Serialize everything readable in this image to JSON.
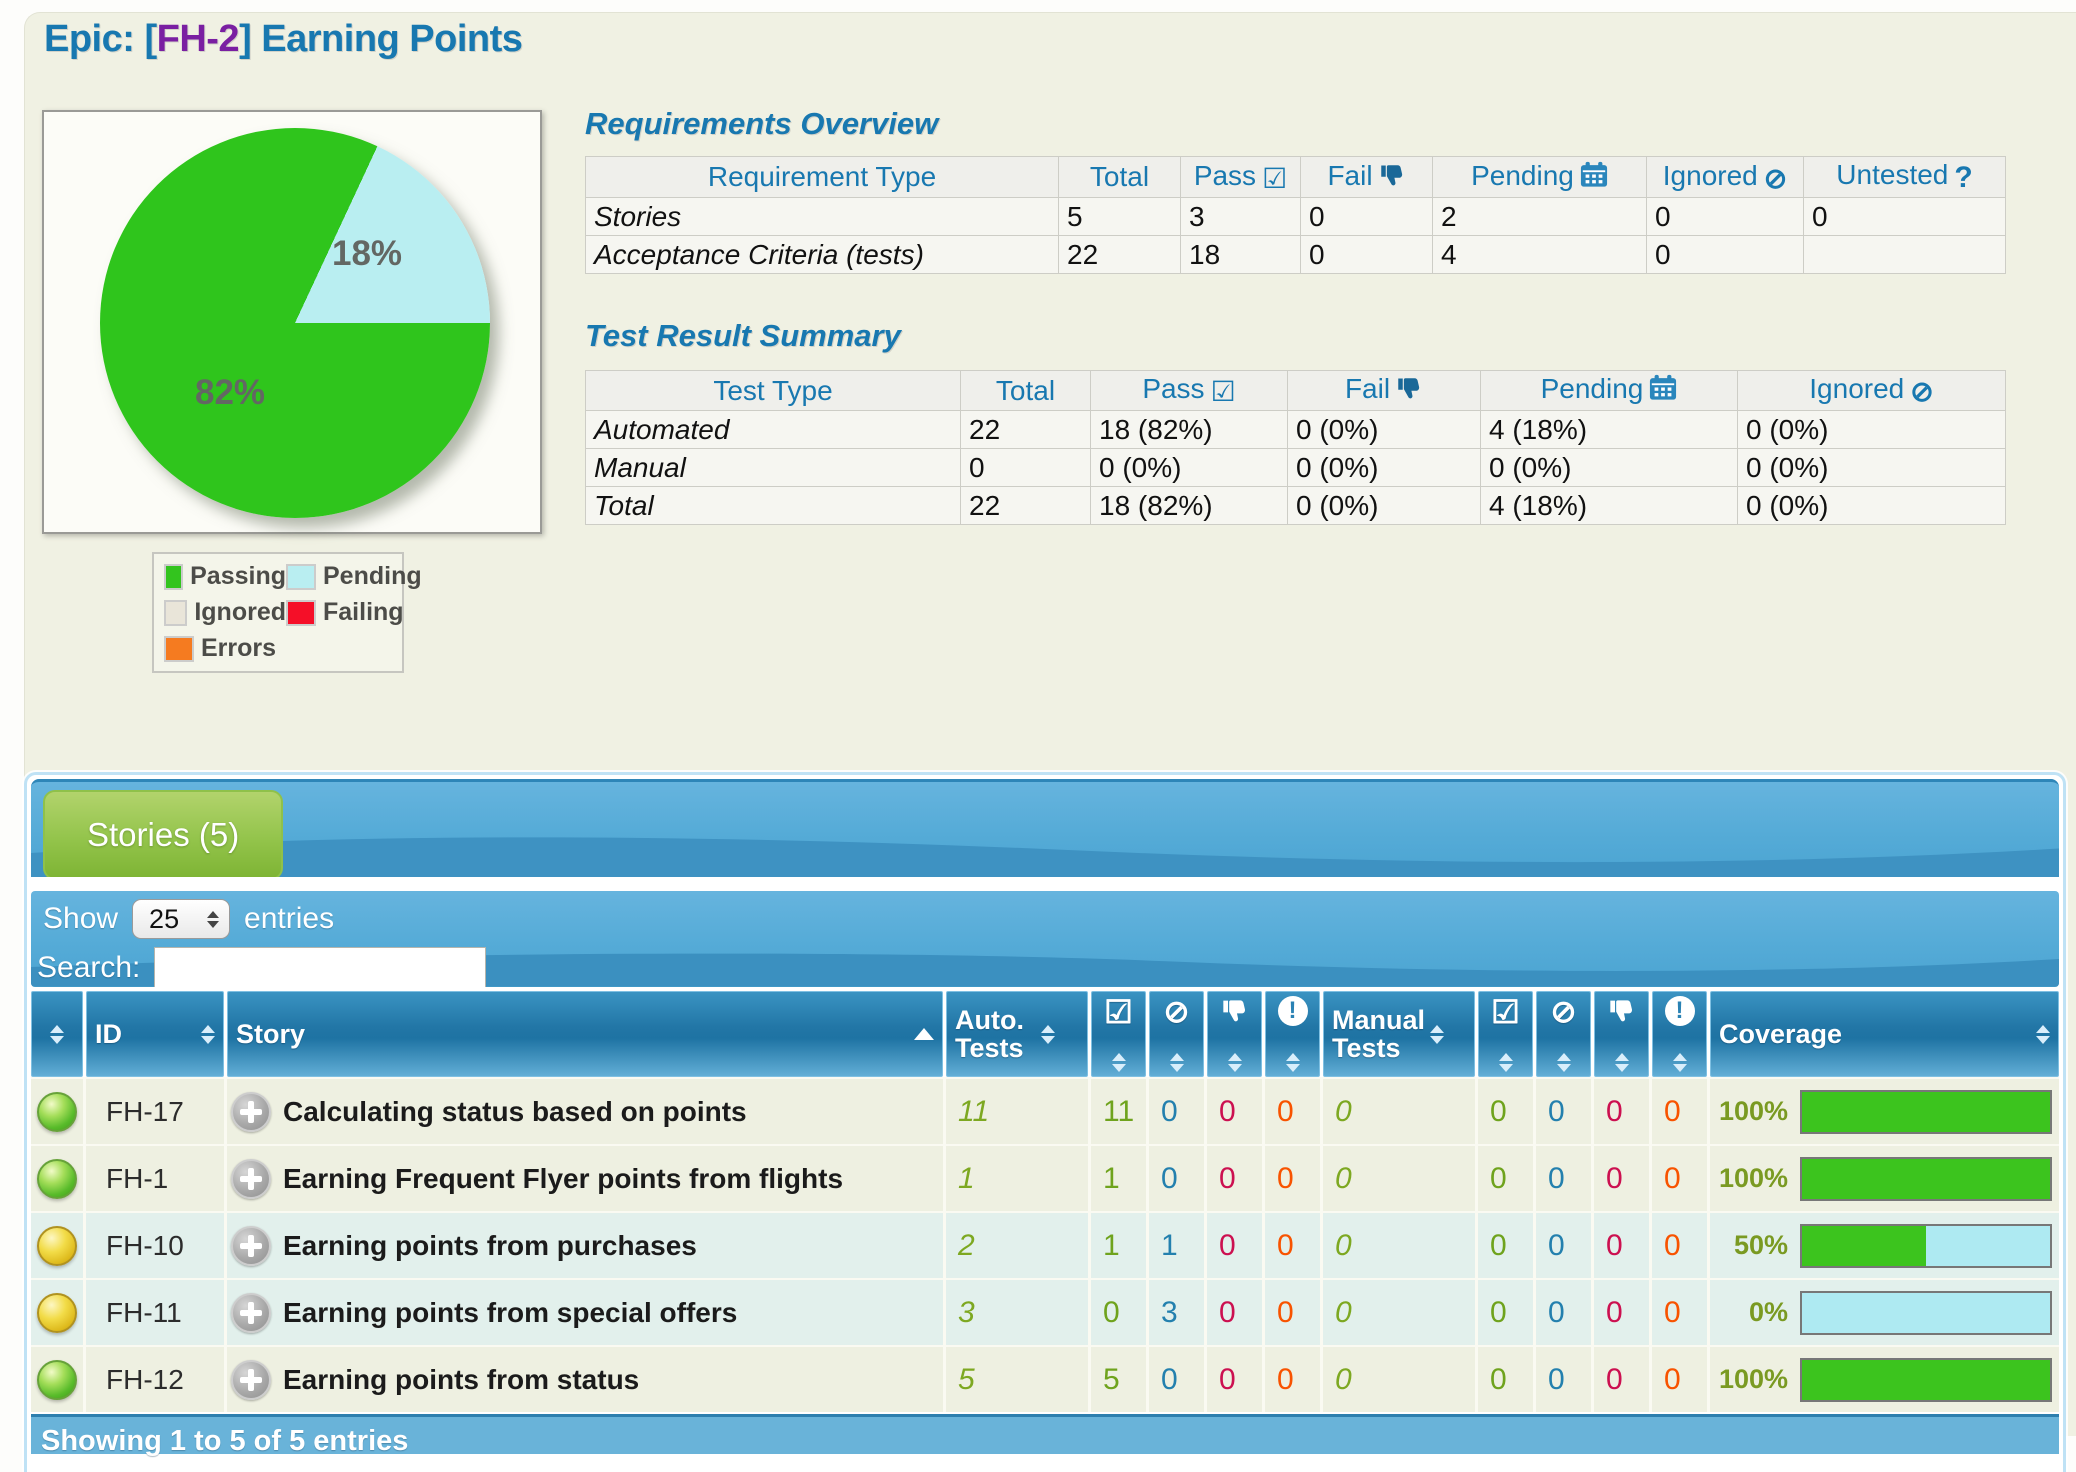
{
  "page_title": {
    "pre": "Epic: [",
    "key": "FH-2",
    "post": "] Earning Points"
  },
  "chart_data": {
    "type": "pie",
    "title": "Epic test results",
    "slices": [
      {
        "label": "Passing",
        "pct": 82,
        "color": "#2fc51c"
      },
      {
        "label": "Pending",
        "pct": 18,
        "color": "#b9eef1"
      }
    ],
    "slice_labels": {
      "passing": "82%",
      "pending": "18%"
    },
    "legend": [
      {
        "label": "Passing",
        "color": "#33c41e"
      },
      {
        "label": "Pending",
        "color": "#b9eef1"
      },
      {
        "label": "Ignored",
        "color": "#e9e5d9"
      },
      {
        "label": "Failing",
        "color": "#f50f28"
      },
      {
        "label": "Errors",
        "color": "#f57b20"
      }
    ]
  },
  "icons": {
    "checkbox_glyph": "☑",
    "no_entry_glyph": "⊘",
    "question_glyph": "?",
    "error_glyph": "!"
  },
  "requirements_overview": {
    "title": "Requirements Overview",
    "columns": [
      "Requirement Type",
      "Total",
      "Pass",
      "Fail",
      "Pending",
      "Ignored",
      "Untested"
    ],
    "rows": [
      {
        "type": "Stories",
        "total": "5",
        "pass": "3",
        "fail": "0",
        "pending": "2",
        "ignored": "0",
        "untested": "0"
      },
      {
        "type": "Acceptance Criteria (tests)",
        "total": "22",
        "pass": "18",
        "fail": "0",
        "pending": "4",
        "ignored": "0",
        "untested": ""
      }
    ]
  },
  "test_result_summary": {
    "title": "Test Result Summary",
    "columns": [
      "Test Type",
      "Total",
      "Pass",
      "Fail",
      "Pending",
      "Ignored"
    ],
    "rows": [
      {
        "type": "Automated",
        "total": "22",
        "pass": "18 (82%)",
        "fail": "0 (0%)",
        "pending": "4 (18%)",
        "ignored": "0 (0%)"
      },
      {
        "type": "Manual",
        "total": "0",
        "pass": "0 (0%)",
        "fail": "0 (0%)",
        "pending": "0 (0%)",
        "ignored": "0 (0%)"
      },
      {
        "type": "Total",
        "total": "22",
        "pass": "18 (82%)",
        "fail": "0 (0%)",
        "pending": "4 (18%)",
        "ignored": "0 (0%)"
      }
    ]
  },
  "stories": {
    "tab_label": "Stories (5)",
    "show_label": "Show",
    "entries_label": "entries",
    "page_size": "25",
    "search_label": "Search:",
    "search_value": "",
    "columns": {
      "id": "ID",
      "story": "Story",
      "auto_tests": "Auto. Tests",
      "manual_tests": "Manual Tests",
      "coverage": "Coverage"
    },
    "icon_columns": [
      "pass",
      "skipped",
      "fail",
      "error"
    ],
    "rows": [
      {
        "status": "green",
        "shade": "base",
        "id": "FH-17",
        "title": "Calculating status based on points",
        "auto_total": "11",
        "auto_pass": "11",
        "auto_skip": "0",
        "auto_fail": "0",
        "auto_err": "0",
        "man_total": "0",
        "man_pass": "0",
        "man_skip": "0",
        "man_fail": "0",
        "man_err": "0",
        "cov_label": "100%",
        "cov_pct": 100
      },
      {
        "status": "green",
        "shade": "base",
        "id": "FH-1",
        "title": "Earning Frequent Flyer points from flights",
        "auto_total": "1",
        "auto_pass": "1",
        "auto_skip": "0",
        "auto_fail": "0",
        "auto_err": "0",
        "man_total": "0",
        "man_pass": "0",
        "man_skip": "0",
        "man_fail": "0",
        "man_err": "0",
        "cov_label": "100%",
        "cov_pct": 100
      },
      {
        "status": "yellow",
        "shade": "alt",
        "id": "FH-10",
        "title": "Earning points from purchases",
        "auto_total": "2",
        "auto_pass": "1",
        "auto_skip": "1",
        "auto_fail": "0",
        "auto_err": "0",
        "man_total": "0",
        "man_pass": "0",
        "man_skip": "0",
        "man_fail": "0",
        "man_err": "0",
        "cov_label": "50%",
        "cov_pct": 50
      },
      {
        "status": "yellow",
        "shade": "alt",
        "id": "FH-11",
        "title": "Earning points from special offers",
        "auto_total": "3",
        "auto_pass": "0",
        "auto_skip": "3",
        "auto_fail": "0",
        "auto_err": "0",
        "man_total": "0",
        "man_pass": "0",
        "man_skip": "0",
        "man_fail": "0",
        "man_err": "0",
        "cov_label": "0%",
        "cov_pct": 0
      },
      {
        "status": "green",
        "shade": "base",
        "id": "FH-12",
        "title": "Earning points from status",
        "auto_total": "5",
        "auto_pass": "5",
        "auto_skip": "0",
        "auto_fail": "0",
        "auto_err": "0",
        "man_total": "0",
        "man_pass": "0",
        "man_skip": "0",
        "man_fail": "0",
        "man_err": "0",
        "cov_label": "100%",
        "cov_pct": 100
      }
    ],
    "footer_text": "Showing 1 to 5 of 5 entries"
  },
  "colors": {
    "accent_blue": "#1878b0",
    "epic_key_purple": "#7a1fa2",
    "banner_blue": "#55abd7",
    "tab_green": "#8fc14a",
    "pass_green": "#3cc41e",
    "pending_cyan": "#aeeaf2",
    "fail_crimson": "#cc1050",
    "error_orange": "#f85300",
    "page_cream": "#f0f1e3"
  }
}
